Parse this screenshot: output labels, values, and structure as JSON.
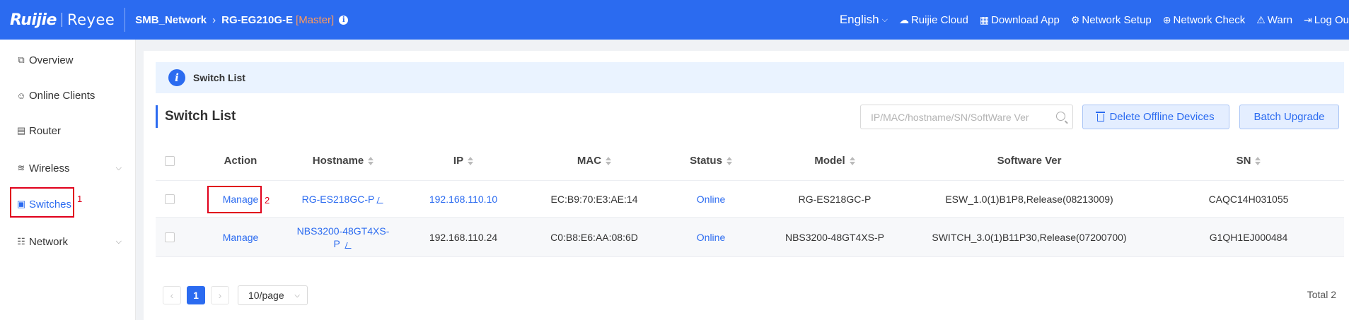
{
  "brand": {
    "logo_primary": "Ruijie",
    "logo_secondary": "Reyee"
  },
  "breadcrumb": {
    "network": "SMB_Network",
    "device": "RG-EG210G-E",
    "role": "[Master]"
  },
  "topnav": {
    "language": "English",
    "items": [
      {
        "label": "Ruijie Cloud",
        "icon": "cloud-icon"
      },
      {
        "label": "Download App",
        "icon": "qr-code-icon"
      },
      {
        "label": "Network Setup",
        "icon": "network-setup-icon"
      },
      {
        "label": "Network Check",
        "icon": "network-check-icon"
      },
      {
        "label": "Warn",
        "icon": "warn-icon"
      },
      {
        "label": "Log Ou",
        "icon": "logout-icon"
      }
    ]
  },
  "sidebar": {
    "items": [
      {
        "label": "Overview",
        "icon": "overview-icon"
      },
      {
        "label": "Online Clients",
        "icon": "clients-icon"
      },
      {
        "label": "Router",
        "icon": "router-icon"
      },
      {
        "label": "Wireless",
        "icon": "wifi-icon",
        "expandable": true
      },
      {
        "label": "Switches",
        "icon": "switch-icon",
        "active": true
      },
      {
        "label": "Network",
        "icon": "network-icon",
        "expandable": true
      }
    ]
  },
  "annotations": {
    "step1": "1",
    "step2": "2"
  },
  "banner": {
    "text": "Switch List"
  },
  "section": {
    "title": "Switch List"
  },
  "search": {
    "placeholder": "IP/MAC/hostname/SN/SoftWare Ver",
    "value": ""
  },
  "buttons": {
    "delete_offline": "Delete Offline Devices",
    "batch_upgrade": "Batch Upgrade"
  },
  "table": {
    "columns": [
      "Action",
      "Hostname",
      "IP",
      "MAC",
      "Status",
      "Model",
      "Software Ver",
      "SN"
    ],
    "rows": [
      {
        "action": "Manage",
        "hostname": "RG-ES218GC-P",
        "ip": "192.168.110.10",
        "mac": "EC:B9:70:E3:AE:14",
        "status": "Online",
        "model": "RG-ES218GC-P",
        "software": "ESW_1.0(1)B1P8,Release(08213009)",
        "sn": "CAQC14H031055"
      },
      {
        "action": "Manage",
        "hostname_line1": "NBS3200-48GT4XS-",
        "hostname_line2": "P",
        "ip": "192.168.110.24",
        "mac": "C0:B8:E6:AA:08:6D",
        "status": "Online",
        "model": "NBS3200-48GT4XS-P",
        "software": "SWITCH_3.0(1)B11P30,Release(07200700)",
        "sn": "G1QH1EJ000484"
      }
    ]
  },
  "pagination": {
    "prev": "‹",
    "current": "1",
    "next": "›",
    "page_size": "10/page",
    "total": "Total 2"
  },
  "colors": {
    "primary": "#2b6bf0",
    "highlight": "#e0001b",
    "master": "#ff9a5c"
  }
}
